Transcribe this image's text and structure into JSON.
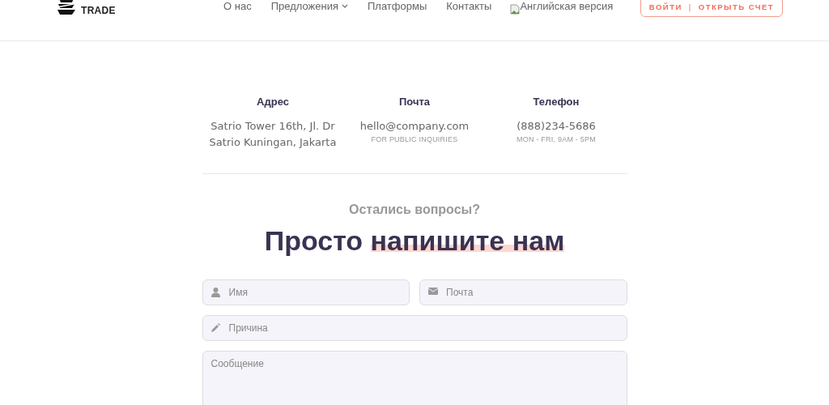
{
  "header": {
    "logo_text": "TRADE",
    "nav": [
      {
        "label": "О нас",
        "dropdown": false
      },
      {
        "label": "Предложения",
        "dropdown": true
      },
      {
        "label": "Платформы",
        "dropdown": false
      },
      {
        "label": "Контакты",
        "dropdown": false
      }
    ],
    "language_image_alt": "Английская версия",
    "login": "ВОЙТИ",
    "separator": "|",
    "open_account": "ОТКРЫТЬ СЧЕТ"
  },
  "contacts": [
    {
      "title": "Адрес",
      "lines": [
        "Satrio Tower 16th, Jl. Dr",
        "Satrio Kuningan, Jakarta"
      ]
    },
    {
      "title": "Почта",
      "lines": [
        "hello@company.com"
      ],
      "note": "FOR PUBLIC INQUIRIES"
    },
    {
      "title": "Телефон",
      "lines": [
        "(888)234-5686"
      ],
      "note": "MON - FRI, 9AM - 5PM"
    }
  ],
  "form": {
    "subtitle": "Остались вопросы?",
    "heading": "Просто",
    "heading_highlight": "напишите нам",
    "fields": [
      {
        "kind": "name",
        "placeholder": "Имя"
      },
      {
        "kind": "email",
        "placeholder": "Почта"
      },
      {
        "kind": "reason",
        "placeholder": "Причина"
      },
      {
        "kind": "message",
        "placeholder": "Сообщение"
      }
    ]
  }
}
